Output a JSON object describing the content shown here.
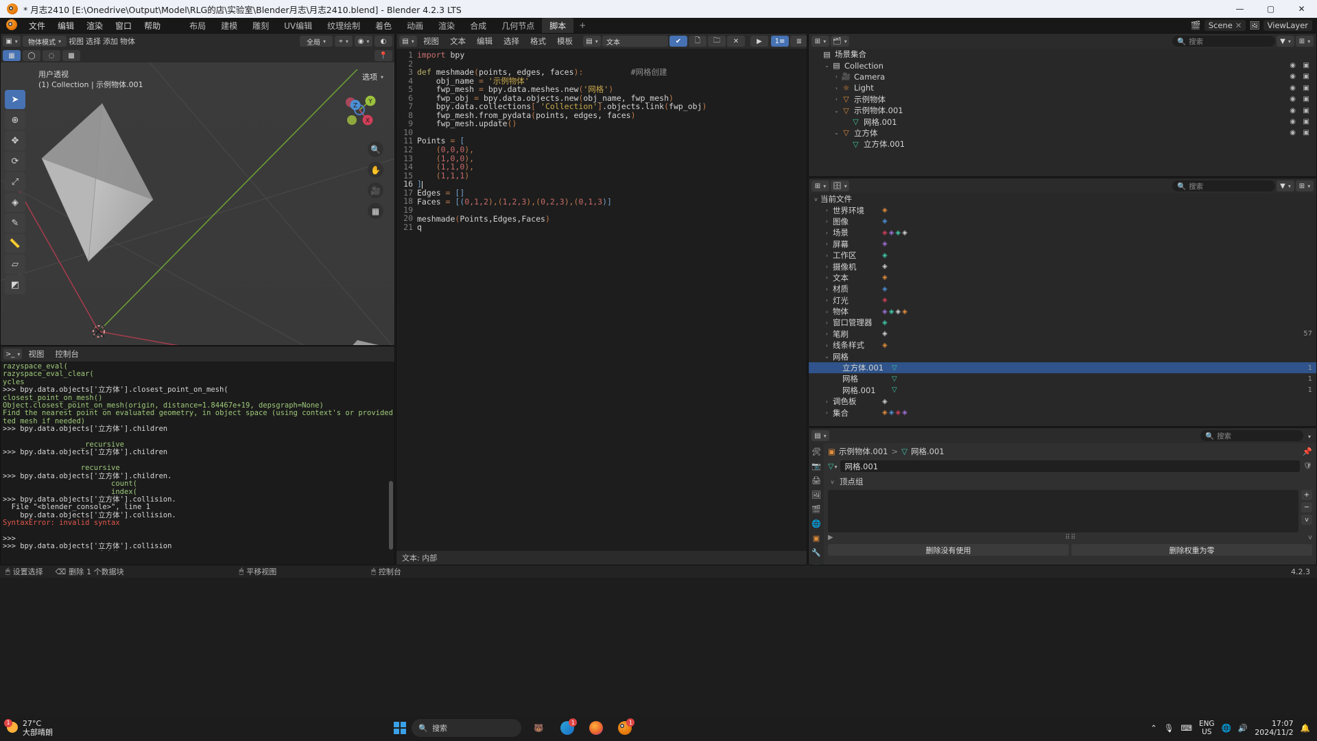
{
  "window": {
    "title": "* 月志2410 [E:\\Onedrive\\Output\\Model\\RLG的店\\实验室\\Blender月志\\月志2410.blend] - Blender 4.2.3 LTS",
    "minimize": "—",
    "maximize": "▢",
    "close": "✕"
  },
  "topbar": {
    "menus": [
      "文件",
      "编辑",
      "渲染",
      "窗口",
      "帮助"
    ],
    "workspaces": [
      "布局",
      "建模",
      "雕刻",
      "UV编辑",
      "纹理绘制",
      "着色",
      "动画",
      "渲染",
      "合成",
      "几何节点",
      "脚本"
    ],
    "active_workspace": "脚本",
    "add_workspace": "+",
    "scene_name": "Scene",
    "viewlayer_name": "ViewLayer"
  },
  "viewport": {
    "mode": "物体模式",
    "menus": [
      "视图",
      "选择",
      "添加",
      "物体"
    ],
    "transform_space": "全局",
    "overlay_label": "选项",
    "info_line1": "用户透视",
    "info_line2": "(1) Collection | 示例物体.001",
    "gizmo_axes": [
      "X",
      "Y",
      "Z"
    ],
    "tools": [
      "tweak",
      "cursor",
      "move",
      "rotate",
      "scale",
      "transform",
      "annotate",
      "measure",
      "add-cube",
      "shear"
    ]
  },
  "console": {
    "menus": [
      "视图",
      "控制台"
    ],
    "lines": [
      {
        "t": "razyspace_eval(",
        "c": "g"
      },
      {
        "t": "razyspace_eval_clear(",
        "c": "g"
      },
      {
        "t": "ycles",
        "c": "g"
      },
      {
        "t": ">>> bpy.data.objects['立方体'].closest_point_on_mesh(",
        "c": "w"
      },
      {
        "t": "closest_point_on_mesh()",
        "c": "g"
      },
      {
        "t": "Object.closest_point_on_mesh(origin, distance=1.84467e+19, depsgraph=None)",
        "c": "g"
      },
      {
        "t": "Find the nearest point on evaluated geometry, in object space (using context's or provided depsgraph to get evalua",
        "c": "g"
      },
      {
        "t": "ted mesh if needed)",
        "c": "g"
      },
      {
        "t": ">>> bpy.data.objects['立方体'].children",
        "c": "w"
      },
      {
        "t": "",
        "c": "w"
      },
      {
        "t": "                  _recursive",
        "c": "g"
      },
      {
        "t": ">>> bpy.data.objects['立方体'].children",
        "c": "w"
      },
      {
        "t": "",
        "c": "w"
      },
      {
        "t": "                  recursive",
        "c": "g"
      },
      {
        "t": ">>> bpy.data.objects['立方体'].children.",
        "c": "w"
      },
      {
        "t": "                         count(",
        "c": "g"
      },
      {
        "t": "                         index(",
        "c": "g"
      },
      {
        "t": ">>> bpy.data.objects['立方体'].collision.",
        "c": "w"
      },
      {
        "t": "  File \"<blender_console>\", line 1",
        "c": "w"
      },
      {
        "t": "    bpy.data.objects['立方体'].collision.",
        "c": "w"
      },
      {
        "t": "SyntaxError: invalid syntax",
        "c": "r"
      },
      {
        "t": "",
        "c": "w"
      },
      {
        "t": ">>> ",
        "c": "w"
      },
      {
        "t": ">>> bpy.data.objects['立方体'].collision",
        "c": "w"
      },
      {
        "t": ">>> bpy.data.objects['立方体']",
        "c": "w"
      }
    ]
  },
  "texteditor": {
    "menus": [
      "视图",
      "文本",
      "编辑",
      "选择",
      "格式",
      "模板"
    ],
    "datablock_name": "文本",
    "footer": "文本: 内部",
    "run_button": "▶",
    "lines": [
      {
        "n": 1,
        "segs": [
          {
            "t": "import ",
            "c": "k-kw"
          },
          {
            "t": "bpy",
            "c": "k-n"
          }
        ]
      },
      {
        "n": 2,
        "segs": []
      },
      {
        "n": 3,
        "segs": [
          {
            "t": "def ",
            "c": "k-def"
          },
          {
            "t": "meshmade",
            "c": "k-n"
          },
          {
            "t": "(",
            "c": "k-op"
          },
          {
            "t": "points, edges, faces",
            "c": "k-n"
          },
          {
            "t": "):",
            "c": "k-op"
          },
          {
            "t": "          ",
            "c": "k-n"
          },
          {
            "t": "#网格创建",
            "c": "k-cm"
          }
        ]
      },
      {
        "n": 4,
        "segs": [
          {
            "t": "    obj_name ",
            "c": "k-n"
          },
          {
            "t": "= ",
            "c": "k-op"
          },
          {
            "t": "'示例物体'",
            "c": "k-str"
          }
        ]
      },
      {
        "n": 5,
        "segs": [
          {
            "t": "    fwp_mesh ",
            "c": "k-n"
          },
          {
            "t": "= ",
            "c": "k-op"
          },
          {
            "t": "bpy.data.meshes.new",
            "c": "k-n"
          },
          {
            "t": "(",
            "c": "k-op"
          },
          {
            "t": "'网格'",
            "c": "k-str"
          },
          {
            "t": ")",
            "c": "k-op"
          }
        ]
      },
      {
        "n": 6,
        "segs": [
          {
            "t": "    fwp_obj ",
            "c": "k-n"
          },
          {
            "t": "= ",
            "c": "k-op"
          },
          {
            "t": "bpy.data.objects.new",
            "c": "k-n"
          },
          {
            "t": "(",
            "c": "k-op"
          },
          {
            "t": "obj_name, fwp_mesh",
            "c": "k-n"
          },
          {
            "t": ")",
            "c": "k-op"
          }
        ]
      },
      {
        "n": 7,
        "segs": [
          {
            "t": "    bpy.data.collections",
            "c": "k-n"
          },
          {
            "t": "[ ",
            "c": "k-op"
          },
          {
            "t": "'Collection'",
            "c": "k-str"
          },
          {
            "t": "]",
            "c": "k-op"
          },
          {
            "t": ".objects.link",
            "c": "k-n"
          },
          {
            "t": "(",
            "c": "k-op"
          },
          {
            "t": "fwp_obj",
            "c": "k-n"
          },
          {
            "t": ")",
            "c": "k-op"
          }
        ]
      },
      {
        "n": 8,
        "segs": [
          {
            "t": "    fwp_mesh.from_pydata",
            "c": "k-n"
          },
          {
            "t": "(",
            "c": "k-op"
          },
          {
            "t": "points, edges, faces",
            "c": "k-n"
          },
          {
            "t": ")",
            "c": "k-op"
          }
        ]
      },
      {
        "n": 9,
        "segs": [
          {
            "t": "    fwp_mesh.update",
            "c": "k-n"
          },
          {
            "t": "()",
            "c": "k-op"
          }
        ]
      },
      {
        "n": 10,
        "segs": []
      },
      {
        "n": 11,
        "segs": [
          {
            "t": "Points ",
            "c": "k-n"
          },
          {
            "t": "= ",
            "c": "k-op"
          },
          {
            "t": "[",
            "c": "k-br"
          }
        ]
      },
      {
        "n": 12,
        "segs": [
          {
            "t": "    (",
            "c": "k-op"
          },
          {
            "t": "0,0,0",
            "c": "k-num"
          },
          {
            "t": "),",
            "c": "k-op"
          }
        ]
      },
      {
        "n": 13,
        "segs": [
          {
            "t": "    (",
            "c": "k-op"
          },
          {
            "t": "1,0,0",
            "c": "k-num"
          },
          {
            "t": "),",
            "c": "k-op"
          }
        ]
      },
      {
        "n": 14,
        "segs": [
          {
            "t": "    (",
            "c": "k-op"
          },
          {
            "t": "1,1,0",
            "c": "k-num"
          },
          {
            "t": "),",
            "c": "k-op"
          }
        ]
      },
      {
        "n": 15,
        "segs": [
          {
            "t": "    (",
            "c": "k-op"
          },
          {
            "t": "1,1,1",
            "c": "k-num"
          },
          {
            "t": ")",
            "c": "k-op"
          }
        ]
      },
      {
        "n": 16,
        "segs": [
          {
            "t": "]",
            "c": "k-br"
          }
        ],
        "cursor": true
      },
      {
        "n": 17,
        "segs": [
          {
            "t": "Edges ",
            "c": "k-n"
          },
          {
            "t": "= ",
            "c": "k-op"
          },
          {
            "t": "[]",
            "c": "k-br"
          }
        ]
      },
      {
        "n": 18,
        "segs": [
          {
            "t": "Faces ",
            "c": "k-n"
          },
          {
            "t": "= ",
            "c": "k-op"
          },
          {
            "t": "[(",
            "c": "k-br"
          },
          {
            "t": "0,1,2",
            "c": "k-num"
          },
          {
            "t": "),(",
            "c": "k-op"
          },
          {
            "t": "1,2,3",
            "c": "k-num"
          },
          {
            "t": "),(",
            "c": "k-op"
          },
          {
            "t": "0,2,3",
            "c": "k-num"
          },
          {
            "t": "),(",
            "c": "k-op"
          },
          {
            "t": "0,1,3",
            "c": "k-num"
          },
          {
            "t": ")]",
            "c": "k-br"
          }
        ]
      },
      {
        "n": 19,
        "segs": []
      },
      {
        "n": 20,
        "segs": [
          {
            "t": "meshmade",
            "c": "k-n"
          },
          {
            "t": "(",
            "c": "k-op"
          },
          {
            "t": "Points,Edges,Faces",
            "c": "k-n"
          },
          {
            "t": ")",
            "c": "k-op"
          }
        ]
      },
      {
        "n": 21,
        "segs": [
          {
            "t": "q",
            "c": "k-n"
          }
        ]
      }
    ]
  },
  "outliner": {
    "search_placeholder": "搜索",
    "rows": [
      {
        "indent": 0,
        "tri": "",
        "icon": "scene-collection-icon",
        "glyph": "▤",
        "color": "#d0d0d0",
        "label": "场景集合",
        "eye": false,
        "cam": false,
        "sel": false
      },
      {
        "indent": 1,
        "tri": "v",
        "icon": "collection-icon",
        "glyph": "▤",
        "color": "#d0d0d0",
        "label": "Collection",
        "eye": true,
        "cam": true,
        "sel": false
      },
      {
        "indent": 2,
        "tri": ">",
        "icon": "camera-icon",
        "glyph": "🎥",
        "color": "#e08c3c",
        "label": "Camera",
        "eye": true,
        "cam": true,
        "sel": false
      },
      {
        "indent": 2,
        "tri": ">",
        "icon": "light-icon",
        "glyph": "☼",
        "color": "#e08c3c",
        "label": "Light",
        "eye": true,
        "cam": true,
        "sel": false
      },
      {
        "indent": 2,
        "tri": ">",
        "icon": "mesh-object-icon",
        "glyph": "▽",
        "color": "#e08c3c",
        "label": "示例物体",
        "eye": true,
        "cam": true,
        "sel": false
      },
      {
        "indent": 2,
        "tri": "v",
        "icon": "mesh-object-icon",
        "glyph": "▽",
        "color": "#e08c3c",
        "label": "示例物体.001",
        "eye": true,
        "cam": true,
        "sel": false
      },
      {
        "indent": 3,
        "tri": "",
        "icon": "mesh-data-icon",
        "glyph": "▽",
        "color": "#3fc9a8",
        "label": "网格.001",
        "eye": true,
        "cam": true,
        "sel": false
      },
      {
        "indent": 2,
        "tri": "v",
        "icon": "mesh-object-icon",
        "glyph": "▽",
        "color": "#e08c3c",
        "label": "立方体",
        "eye": true,
        "cam": true,
        "sel": false
      },
      {
        "indent": 3,
        "tri": "",
        "icon": "mesh-data-icon",
        "glyph": "▽",
        "color": "#3fc9a8",
        "label": "立方体.001",
        "eye": false,
        "cam": false,
        "sel": false
      }
    ]
  },
  "blenderfile": {
    "search_placeholder": "搜索",
    "title": "当前文件",
    "rows": [
      {
        "tri": ">",
        "label": "世界环境",
        "icons": [
          "world"
        ],
        "indent": 1,
        "sel": false
      },
      {
        "tri": ">",
        "label": "图像",
        "icons": [
          "image"
        ],
        "indent": 1,
        "sel": false
      },
      {
        "tri": ">",
        "label": "场景",
        "icons": [
          "scene",
          "scene2",
          "scene3",
          "scene4"
        ],
        "indent": 1,
        "sel": false
      },
      {
        "tri": ">",
        "label": "屏幕",
        "icons": [
          "screen"
        ],
        "indent": 1,
        "sel": false
      },
      {
        "tri": ">",
        "label": "工作区",
        "icons": [
          "workspace"
        ],
        "indent": 1,
        "sel": false
      },
      {
        "tri": ">",
        "label": "摄像机",
        "icons": [
          "camera"
        ],
        "indent": 1,
        "sel": false
      },
      {
        "tri": ">",
        "label": "文本",
        "icons": [
          "text"
        ],
        "indent": 1,
        "sel": false
      },
      {
        "tri": ">",
        "label": "材质",
        "icons": [
          "material"
        ],
        "indent": 1,
        "sel": false
      },
      {
        "tri": ">",
        "label": "灯光",
        "icons": [
          "light"
        ],
        "indent": 1,
        "sel": false
      },
      {
        "tri": ">",
        "label": "物体",
        "icons": [
          "object",
          "object2",
          "object3",
          "object4"
        ],
        "indent": 1,
        "sel": false
      },
      {
        "tri": ">",
        "label": "窗口管理器",
        "icons": [
          "window"
        ],
        "indent": 1,
        "sel": false
      },
      {
        "tri": ">",
        "label": "笔刷",
        "icons": [
          "brush"
        ],
        "indent": 1,
        "count": "57",
        "sel": false
      },
      {
        "tri": ">",
        "label": "线条样式",
        "icons": [
          "linestyle"
        ],
        "indent": 1,
        "sel": false
      },
      {
        "tri": "v",
        "label": "网格",
        "icons": [],
        "indent": 1,
        "sel": false
      },
      {
        "tri": "",
        "label": "立方体.001",
        "icons": [
          "meshdata"
        ],
        "indent": 2,
        "count": "1",
        "sel": true
      },
      {
        "tri": "",
        "label": "网格",
        "icons": [
          "meshdata"
        ],
        "indent": 2,
        "count": "1",
        "sel": false
      },
      {
        "tri": "",
        "label": "网格.001",
        "icons": [
          "meshdata"
        ],
        "indent": 2,
        "count": "1",
        "sel": false
      },
      {
        "tri": ">",
        "label": "调色板",
        "icons": [
          "palette"
        ],
        "indent": 1,
        "sel": false
      },
      {
        "tri": ">",
        "label": "集合",
        "icons": [
          "coll",
          "coll2",
          "coll3",
          "coll4"
        ],
        "indent": 1,
        "sel": false
      }
    ]
  },
  "properties": {
    "search_placeholder": "搜索",
    "breadcrumb": [
      "示例物体.001",
      "网格.001"
    ],
    "datablock_name": "网格.001",
    "panel_title": "顶点组",
    "buttons": [
      "删除没有使用",
      "删除权重为零"
    ],
    "tabs": [
      "tool",
      "render",
      "output",
      "viewlayer",
      "scene",
      "world",
      "object",
      "modifier",
      "data",
      "material"
    ]
  },
  "statusbar": {
    "left_items": [
      "设置选择",
      "删除",
      "1 个数据块"
    ],
    "mouse_hint": "平移视图",
    "console_hint": "控制台",
    "version": "4.2.3"
  },
  "taskbar": {
    "temperature": "27°C",
    "weather": "大部晴朗",
    "weather_badge": "1",
    "search_placeholder": "搜索",
    "apps": [
      {
        "name": "edge-icon",
        "badge": "1"
      },
      {
        "name": "firefox-icon",
        "badge": ""
      },
      {
        "name": "blender-icon",
        "badge": "1"
      }
    ],
    "lang_top": "ENG",
    "lang_bottom": "US",
    "time": "17:07",
    "date": "2024/11/2"
  }
}
